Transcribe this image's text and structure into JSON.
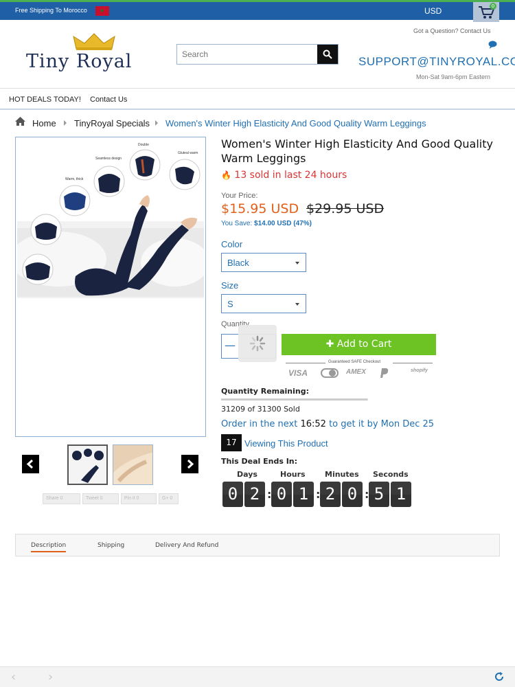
{
  "topbar": {
    "shipping_text": "Free Shipping To Morocco",
    "currency": "USD",
    "cart_count": "0"
  },
  "header": {
    "logo_text": "Tiny Royal",
    "search_placeholder": "Search",
    "question_text": "Got a Question? Contact Us",
    "support_email": "SUPPORT@TINYROYAL.COM",
    "hours": "Mon-Sat 9am-6pm Eastern"
  },
  "nav": {
    "items": [
      "HOT DEALS TODAY!",
      "Contact Us"
    ]
  },
  "breadcrumb": {
    "home": "Home",
    "category": "TinyRoyal Specials",
    "current": "Women's Winter High Elasticity And Good Quality Warm Leggings"
  },
  "product": {
    "title": "Women's Winter High Elasticity And Good Quality Warm Leggings",
    "sold_recent": "13 sold in last 24 hours",
    "price_label": "Your Price:",
    "price": "$15.95 USD",
    "old_price": "$29.95 USD",
    "you_save_label": "You Save:",
    "you_save_value": "$14.00 USD (47%)",
    "color_label": "Color",
    "color_value": "Black",
    "size_label": "Size",
    "size_value": "S",
    "quantity_label": "Quantity",
    "quantity_minus": "—",
    "add_to_cart": "Add to Cart",
    "safe_checkout": "Guaranteed SAFE Checkout",
    "payment_methods": [
      "VISA",
      "AMEX",
      "shopify"
    ],
    "quantity_remaining_label": "Quantity Remaining:",
    "quantity_sold_fraction": 0.997,
    "quantity_sold_text": "31209 of 31300 Sold",
    "order_prefix": "Order in the next",
    "order_time": "16:52",
    "order_suffix": "to get it by Mon Dec 25",
    "viewing_count": "17",
    "viewing_text": "Viewing This Product",
    "deal_ends_label": "This Deal Ends In:",
    "countdown_labels": [
      "Days",
      "Hours",
      "Minutes",
      "Seconds"
    ],
    "countdown_digits": [
      "0",
      "2",
      "0",
      "1",
      "2",
      "0",
      "5",
      "1"
    ],
    "image_callouts": [
      "Double",
      "Seamless design",
      "Warm, thick",
      "Gluteal warm"
    ]
  },
  "share": {
    "buttons": [
      "Share 0",
      "Tweet 0",
      "Pin it 0",
      "G+ 0"
    ]
  },
  "tabs": {
    "items": [
      "Description",
      "Shipping",
      "Delivery And Refund"
    ]
  }
}
